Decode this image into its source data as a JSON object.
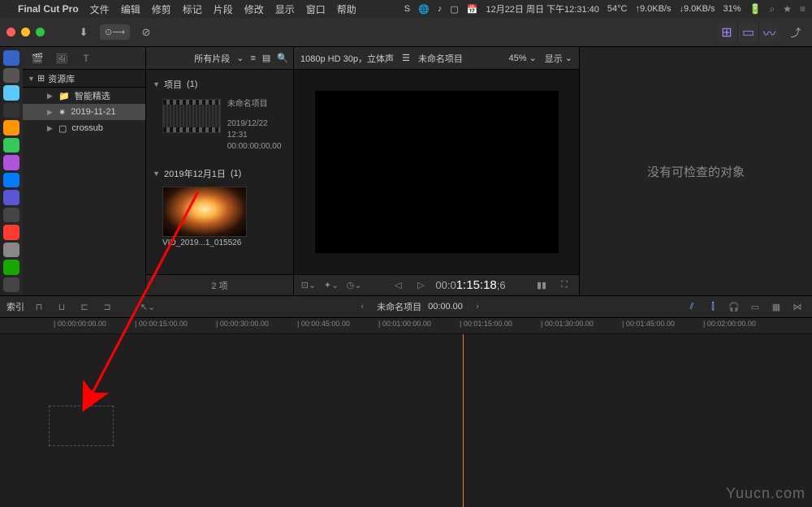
{
  "menubar": {
    "app_name": "Final Cut Pro",
    "items": [
      "文件",
      "编辑",
      "修剪",
      "标记",
      "片段",
      "修改",
      "显示",
      "窗口",
      "帮助"
    ],
    "status": {
      "date": "12月22日 周日 下午12:31:40",
      "temp": "54°C",
      "net_up": "↑9.0KB/s",
      "net_down": "↓9.0KB/s",
      "battery": "31%"
    }
  },
  "library": {
    "title": "资源库",
    "items": [
      {
        "label": "智能精选",
        "indent": 1
      },
      {
        "label": "2019-11-21",
        "indent": 1,
        "selected": true
      },
      {
        "label": "crossub",
        "indent": 1
      }
    ]
  },
  "browser": {
    "filter": "所有片段",
    "sections": [
      {
        "title": "项目",
        "count": "(1)"
      },
      {
        "title": "2019年12月1日",
        "count": "(1)"
      }
    ],
    "project": {
      "name": "未命名项目",
      "date": "2019/12/22 12:31",
      "duration": "00:00:00;00,00"
    },
    "clip": {
      "name": "VID_2019...1_015526"
    },
    "footer": "2 项"
  },
  "viewer": {
    "format": "1080p HD 30p，立体声",
    "project_name": "未命名项目",
    "zoom": "45%",
    "display_label": "显示",
    "timecode_prefix": "00:0",
    "timecode": "1:15:18",
    "timecode_frames": ";6"
  },
  "inspector": {
    "empty_text": "没有可检查的对象"
  },
  "timeline": {
    "index_label": "索引",
    "project_name": "未命名项目",
    "duration": "00:00.00",
    "ruler_ticks": [
      {
        "pos": 66,
        "label": "00:00:00:00.00"
      },
      {
        "pos": 166,
        "label": "00:00:15:00.00"
      },
      {
        "pos": 266,
        "label": "00:00:30:00.00"
      },
      {
        "pos": 366,
        "label": "00:00:45:00.00"
      },
      {
        "pos": 466,
        "label": "00:01:00:00.00"
      },
      {
        "pos": 566,
        "label": "00:01:15:00.00"
      },
      {
        "pos": 666,
        "label": "00:01:30:00.00"
      },
      {
        "pos": 766,
        "label": "00:01:45:00.00"
      },
      {
        "pos": 866,
        "label": "00:02:00:00.00"
      }
    ]
  },
  "watermark": "Yuucn.com"
}
